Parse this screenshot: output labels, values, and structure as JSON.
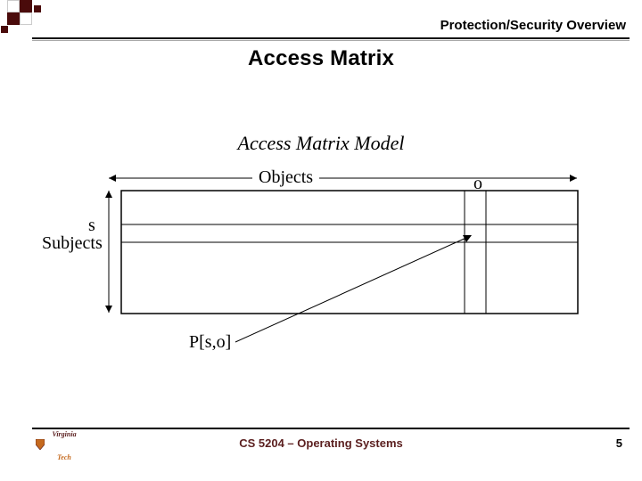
{
  "header": {
    "breadcrumb": "Protection/Security Overview"
  },
  "title": "Access Matrix",
  "subtitle": "Access Matrix Model",
  "labels": {
    "objects": "Objects",
    "o": "o",
    "s": "s",
    "subjects": "Subjects",
    "pso": "P[s,o]"
  },
  "footer": {
    "course": "CS 5204 – Operating Systems",
    "page": "5",
    "logo_top": "Virginia",
    "logo_bottom": "Tech"
  },
  "colors": {
    "dark_red": "#4a0b0b",
    "accent": "#c56a1f"
  }
}
